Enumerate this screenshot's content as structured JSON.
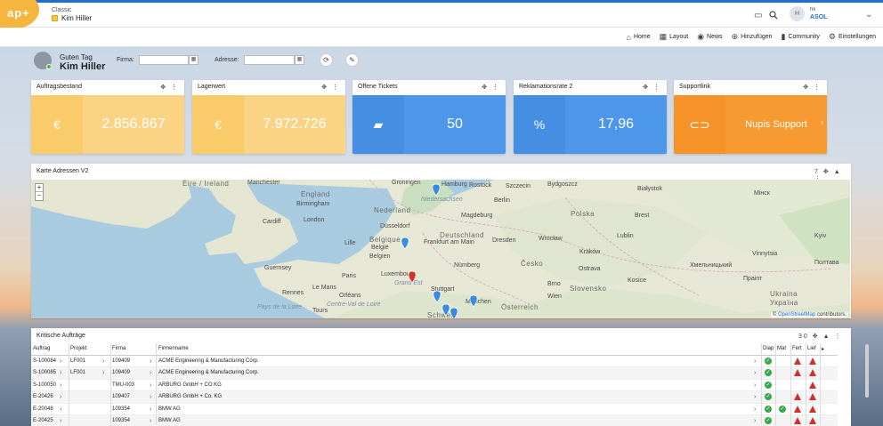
{
  "app": {
    "logo_text": "ap+",
    "view": "Classic",
    "user_name": "Kim Hiller",
    "avatar_initial": "H",
    "user_short": "hk",
    "company": "ASOL"
  },
  "menu": [
    {
      "icon": "home-icon",
      "label": "Home"
    },
    {
      "icon": "layout-icon",
      "label": "Layout"
    },
    {
      "icon": "news-icon",
      "label": "News"
    },
    {
      "icon": "add-icon",
      "label": "Hinzufügen"
    },
    {
      "icon": "community-icon",
      "label": "Community"
    },
    {
      "icon": "gear-icon",
      "label": "Einstellungen"
    }
  ],
  "greeting": {
    "hello": "Guten Tag",
    "name": "Kim Hiller"
  },
  "filters": {
    "firma_label": "Firma:",
    "firma_value": "",
    "adresse_label": "Adresse:",
    "adresse_value": ""
  },
  "cards": [
    {
      "title": "Auftragsbestand",
      "icon": "€",
      "value": "2.856.867",
      "colors": [
        "#f9c455",
        "#fbd385"
      ]
    },
    {
      "title": "Lagerwert",
      "icon": "€",
      "value": "7.972.726",
      "colors": [
        "#f9c455",
        "#fbd385"
      ]
    },
    {
      "title": "Offene Tickets",
      "icon": "ticket-icon",
      "value": "50",
      "colors": [
        "#2b7fe0",
        "#4d97ea"
      ]
    },
    {
      "title": "Reklamationsrate 2",
      "icon": "%",
      "value": "17,96",
      "colors": [
        "#2b7fe0",
        "#4d97ea"
      ]
    },
    {
      "title": "Supportlink",
      "icon": "link-icon",
      "value": "Nupis Support",
      "colors": [
        "#f5840b",
        "#f79a31"
      ]
    }
  ],
  "map_panel": {
    "title": "Karte Adressen V2",
    "count": "7",
    "zoom_in": "+",
    "zoom_out": "−",
    "attribution_prefix": "©",
    "attribution_link": "OpenStreetMap",
    "attribution_suffix": "contributors.",
    "labels": [
      "Éire / Ireland",
      "Manchester",
      "England",
      "Birmingham",
      "Cardiff",
      "London",
      "Guernsey",
      "Rennes",
      "Paris",
      "Lille",
      "Belgique",
      "België",
      "Belgien",
      "Luxembourg",
      "Nederland",
      "Groningen",
      "Hamburg",
      "Niedersachsen",
      "Düsseldorf",
      "Frankfurt am Main",
      "Deutschland",
      "Magdeburg",
      "Szczecin",
      "Bydgoszcz",
      "Białystok",
      "Polska",
      "Brest",
      "Lublin",
      "Wrocław",
      "Dresden",
      "Česko",
      "Nürnberg",
      "Kraków",
      "Stuttgart",
      "München",
      "Österreich",
      "Schweiz",
      "Slovensko",
      "Grand Est",
      "Centre-Val de Loire",
      "Pays de la Loire",
      "Le Mans",
      "Tours",
      "Orléans",
      "Ukraina",
      "Україна",
      "Праіпт",
      "Brno",
      "Kosice",
      "Wien",
      "Ostrava",
      "Berlin",
      "Rostock",
      "Kyiv",
      "Мінск",
      "Полтава",
      "Vinnytsia",
      "Хмельницький"
    ]
  },
  "orders_panel": {
    "title": "Kritische Aufträge",
    "count": "30",
    "columns": [
      "Auftrag",
      "Projekt",
      "Firma",
      "Firmenname",
      "Diap",
      "Mat",
      "Fert",
      "Lief"
    ],
    "rows": [
      {
        "auftrag": "S-100084",
        "projekt": "LF001",
        "firma": "109409",
        "name": "ACME Engineering & Manufacturing Corp.",
        "diap": "ok",
        "mat": "",
        "fert": "warn",
        "lief": "warn"
      },
      {
        "auftrag": "S-100085",
        "projekt": "LF001",
        "firma": "109409",
        "name": "ACME Engineering & Manufacturing Corp.",
        "diap": "ok",
        "mat": "",
        "fert": "warn",
        "lief": "warn"
      },
      {
        "auftrag": "S-100050",
        "projekt": "",
        "firma": "TMU-003",
        "name": "ARBURG GmbH + CO KG",
        "diap": "ok",
        "mat": "",
        "fert": "",
        "lief": "warn"
      },
      {
        "auftrag": "E-20426",
        "projekt": "",
        "firma": "109407",
        "name": "ARBURG GmbH + Co. KG",
        "diap": "ok",
        "mat": "",
        "fert": "warn",
        "lief": "warn"
      },
      {
        "auftrag": "E-20048",
        "projekt": "",
        "firma": "109354",
        "name": "BMW AG",
        "diap": "ok",
        "mat": "ok",
        "fert": "warn",
        "lief": "warn"
      },
      {
        "auftrag": "E-20425",
        "projekt": "",
        "firma": "109354",
        "name": "BMW AG",
        "diap": "ok",
        "mat": "",
        "fert": "warn",
        "lief": "warn"
      }
    ]
  }
}
